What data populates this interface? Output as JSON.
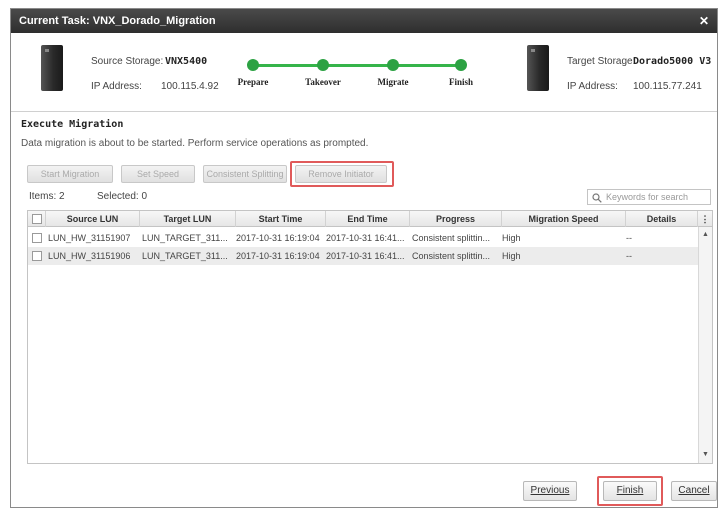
{
  "title": "Current Task: VNX_Dorado_Migration",
  "source": {
    "storage_label": "Source Storage:",
    "storage_name": "VNX5400",
    "ip_label": "IP Address:",
    "ip": "100.115.4.92"
  },
  "target": {
    "storage_label": "Target Storage:",
    "storage_name": "Dorado5000 V3",
    "ip_label": "IP Address:",
    "ip": "100.115.77.241"
  },
  "steps": [
    "Prepare",
    "Takeover",
    "Migrate",
    "Finish"
  ],
  "section": {
    "title": "Execute Migration",
    "description": "Data migration is about to be started. Perform service operations as prompted."
  },
  "toolbar": {
    "buttons": [
      "Start Migration",
      "Set Speed",
      "Consistent Splitting",
      "Remove Initiator"
    ]
  },
  "counts": {
    "items_label": "Items:",
    "items": "2",
    "selected_label": "Selected:",
    "selected": "0"
  },
  "search": {
    "placeholder": "Keywords for search"
  },
  "table": {
    "columns": [
      "Source LUN",
      "Target LUN",
      "Start Time",
      "End Time",
      "Progress",
      "Migration Speed",
      "Details"
    ],
    "rows": [
      [
        "LUN_HW_31151907",
        "LUN_TARGET_311...",
        "2017-10-31 16:19:04",
        "2017-10-31 16:41...",
        "Consistent splittin...",
        "High",
        "--"
      ],
      [
        "LUN_HW_31151906",
        "LUN_TARGET_311...",
        "2017-10-31 16:19:04",
        "2017-10-31 16:41...",
        "Consistent splittin...",
        "High",
        "--"
      ]
    ]
  },
  "footer": {
    "previous": "Previous",
    "finish": "Finish",
    "cancel": "Cancel"
  },
  "colors": {
    "progress_green": "#35b44a",
    "highlight_red": "#e05a5a",
    "titlebar": "#3a3a3a"
  }
}
